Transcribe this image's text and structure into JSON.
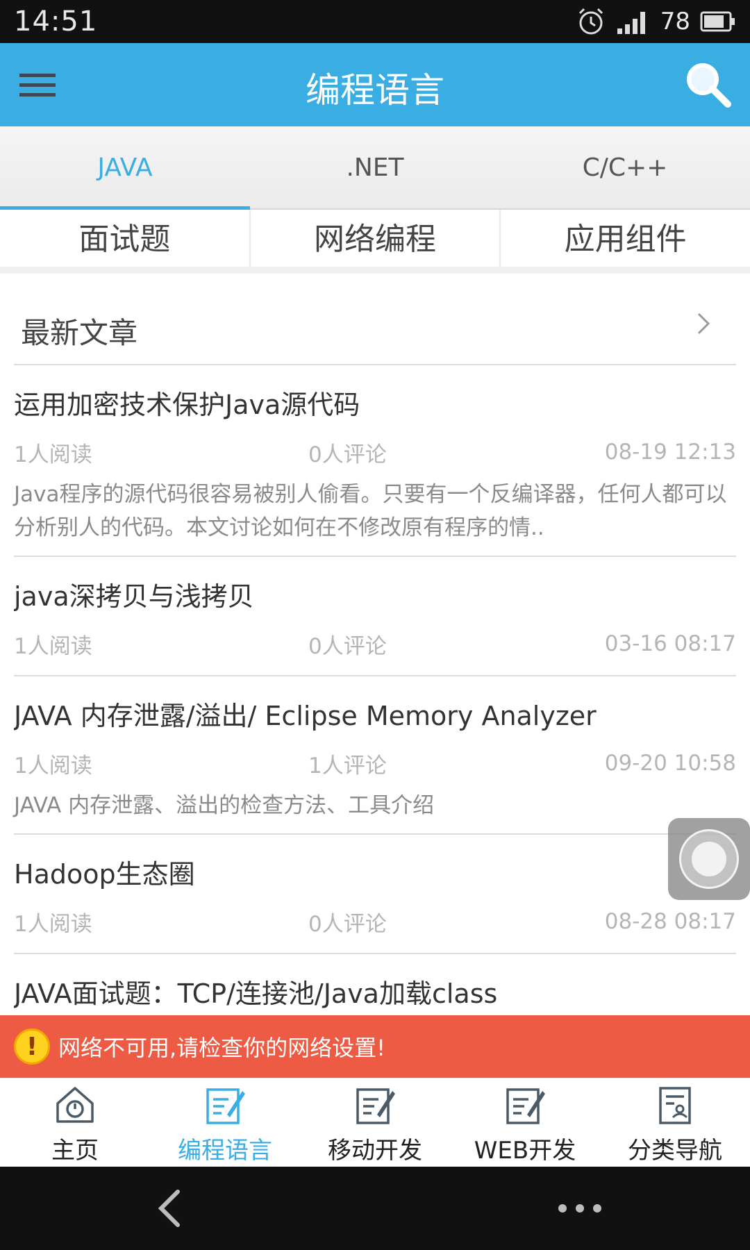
{
  "status_bar": {
    "time": "14:51",
    "battery": "78"
  },
  "app_bar": {
    "title": "编程语言",
    "menu_icon": "hamburger-menu-icon",
    "search_icon": "search-icon"
  },
  "tabs": [
    {
      "label": "JAVA",
      "active": true
    },
    {
      "label": ".NET",
      "active": false
    },
    {
      "label": "C/C++",
      "active": false
    }
  ],
  "subcategories": [
    "面试题",
    "网络编程",
    "应用组件"
  ],
  "section": {
    "title": "最新文章"
  },
  "articles": [
    {
      "title": "运用加密技术保护Java源代码",
      "reads": "1人阅读",
      "comments": "0人评论",
      "date": "08-19 12:13",
      "summary": "Java程序的源代码很容易被别人偷看。只要有一个反编译器，任何人都可以分析别人的代码。本文讨论如何在不修改原有程序的情.."
    },
    {
      "title": "java深拷贝与浅拷贝",
      "reads": "1人阅读",
      "comments": "0人评论",
      "date": "03-16 08:17",
      "summary": ""
    },
    {
      "title": "JAVA  内存泄露/溢出/ Eclipse Memory Analyzer",
      "reads": "1人阅读",
      "comments": "1人评论",
      "date": "09-20 10:58",
      "summary": "JAVA  内存泄露、溢出的检查方法、工具介绍"
    },
    {
      "title": "Hadoop生态圈",
      "reads": "1人阅读",
      "comments": "0人评论",
      "date": "08-28 08:17",
      "summary": ""
    },
    {
      "title": "JAVA面试题：TCP/连接池/Java加载class",
      "reads": "",
      "comments": "",
      "date": "",
      "summary": ""
    }
  ],
  "network_banner": {
    "text": "网络不可用,请检查你的网络设置!"
  },
  "bottom_nav": [
    {
      "label": "主页",
      "icon": "home-icon",
      "active": false
    },
    {
      "label": "编程语言",
      "icon": "edit-note-icon",
      "active": true
    },
    {
      "label": "移动开发",
      "icon": "edit-note-icon",
      "active": false
    },
    {
      "label": "WEB开发",
      "icon": "edit-note-icon",
      "active": false
    },
    {
      "label": "分类导航",
      "icon": "category-doc-icon",
      "active": false
    }
  ],
  "colors": {
    "accent": "#3aaee3",
    "banner": "#ed5b45",
    "warn": "#ffd21f"
  }
}
